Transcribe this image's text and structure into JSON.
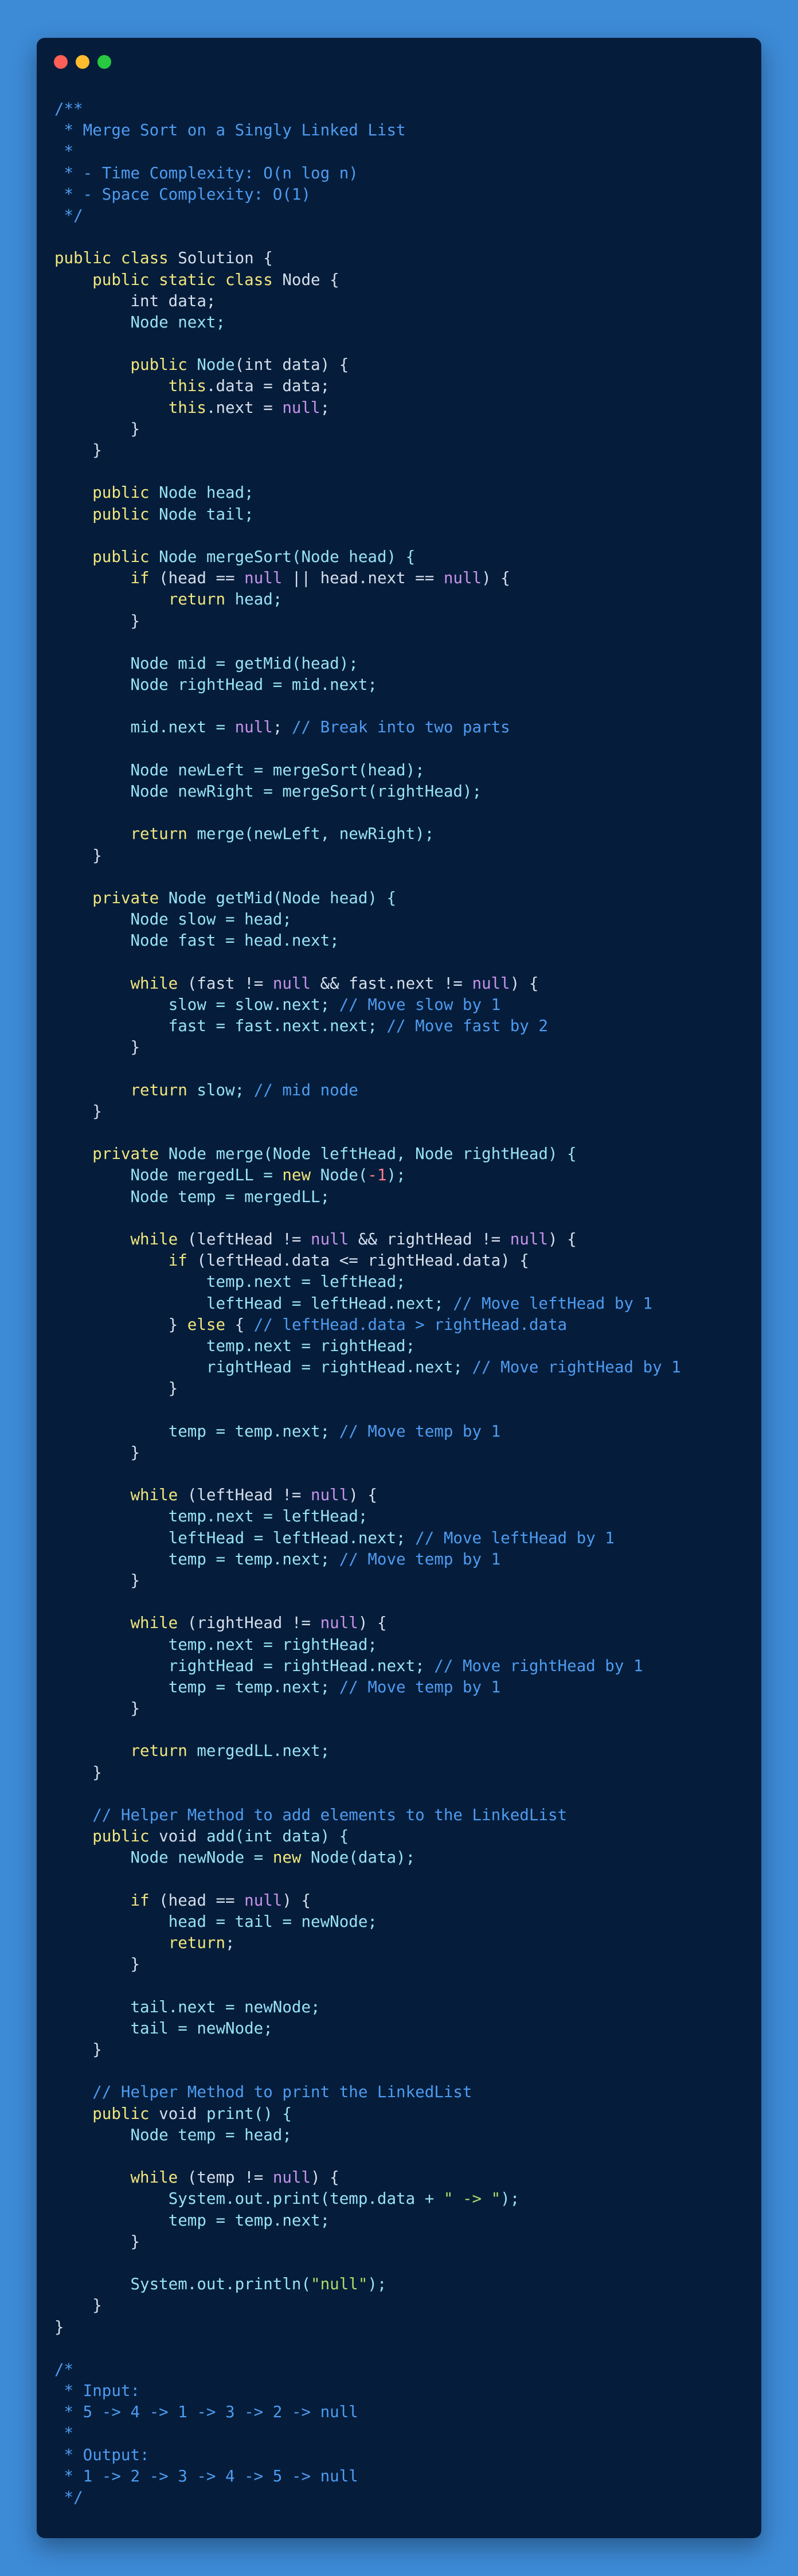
{
  "window": {
    "background": "#051d3b",
    "page_background": "#3d8ad6",
    "controls": [
      {
        "name": "close",
        "color": "#ff5f57"
      },
      {
        "name": "minimize",
        "color": "#febc2e"
      },
      {
        "name": "maximize",
        "color": "#28c840"
      }
    ]
  },
  "palette": {
    "p": "#d6deeb",
    "k": "#f2e67d",
    "c": "#4f9bf0",
    "t": "#99e2f6",
    "n": "#c792ea",
    "s": "#addb67",
    "o": "#ff7e8b"
  },
  "code_lines": [
    [
      [
        "c",
        "/**"
      ]
    ],
    [
      [
        "c",
        " * Merge Sort on a Singly Linked List"
      ]
    ],
    [
      [
        "c",
        " *"
      ]
    ],
    [
      [
        "c",
        " * - Time Complexity: O(n log n)"
      ]
    ],
    [
      [
        "c",
        " * - Space Complexity: O(1)"
      ]
    ],
    [
      [
        "c",
        " */"
      ]
    ],
    [],
    [
      [
        "k",
        "public class "
      ],
      [
        "p",
        "Solution {"
      ]
    ],
    [
      [
        "p",
        "    "
      ],
      [
        "k",
        "public static class "
      ],
      [
        "p",
        "Node {"
      ]
    ],
    [
      [
        "p",
        "        int data;"
      ]
    ],
    [
      [
        "p",
        "        "
      ],
      [
        "t",
        "Node next;"
      ]
    ],
    [],
    [
      [
        "p",
        "        "
      ],
      [
        "k",
        "public "
      ],
      [
        "t",
        "Node"
      ],
      [
        "p",
        "(int data) {"
      ]
    ],
    [
      [
        "p",
        "            "
      ],
      [
        "k",
        "this"
      ],
      [
        "p",
        ".data = data;"
      ]
    ],
    [
      [
        "p",
        "            "
      ],
      [
        "k",
        "this"
      ],
      [
        "p",
        ".next = "
      ],
      [
        "n",
        "null"
      ],
      [
        "p",
        ";"
      ]
    ],
    [
      [
        "p",
        "        }"
      ]
    ],
    [
      [
        "p",
        "    }"
      ]
    ],
    [],
    [
      [
        "p",
        "    "
      ],
      [
        "k",
        "public "
      ],
      [
        "t",
        "Node head;"
      ]
    ],
    [
      [
        "p",
        "    "
      ],
      [
        "k",
        "public "
      ],
      [
        "t",
        "Node tail;"
      ]
    ],
    [],
    [
      [
        "p",
        "    "
      ],
      [
        "k",
        "public "
      ],
      [
        "t",
        "Node mergeSort(Node head) {"
      ]
    ],
    [
      [
        "p",
        "        "
      ],
      [
        "k",
        "if "
      ],
      [
        "p",
        "(head == "
      ],
      [
        "n",
        "null"
      ],
      [
        "p",
        " || head.next == "
      ],
      [
        "n",
        "null"
      ],
      [
        "p",
        ") {"
      ]
    ],
    [
      [
        "p",
        "            "
      ],
      [
        "k",
        "return "
      ],
      [
        "t",
        "head;"
      ]
    ],
    [
      [
        "p",
        "        }"
      ]
    ],
    [],
    [
      [
        "p",
        "        "
      ],
      [
        "t",
        "Node mid = getMid(head);"
      ]
    ],
    [
      [
        "p",
        "        "
      ],
      [
        "t",
        "Node rightHead = mid.next;"
      ]
    ],
    [],
    [
      [
        "p",
        "        "
      ],
      [
        "t",
        "mid.next = "
      ],
      [
        "n",
        "null"
      ],
      [
        "p",
        "; "
      ],
      [
        "c",
        "// Break into two parts"
      ]
    ],
    [],
    [
      [
        "p",
        "        "
      ],
      [
        "t",
        "Node newLeft = mergeSort(head);"
      ]
    ],
    [
      [
        "p",
        "        "
      ],
      [
        "t",
        "Node newRight = mergeSort(rightHead);"
      ]
    ],
    [],
    [
      [
        "p",
        "        "
      ],
      [
        "k",
        "return "
      ],
      [
        "t",
        "merge(newLeft, newRight);"
      ]
    ],
    [
      [
        "p",
        "    }"
      ]
    ],
    [],
    [
      [
        "p",
        "    "
      ],
      [
        "k",
        "private "
      ],
      [
        "t",
        "Node getMid(Node head) {"
      ]
    ],
    [
      [
        "p",
        "        "
      ],
      [
        "t",
        "Node slow = head;"
      ]
    ],
    [
      [
        "p",
        "        "
      ],
      [
        "t",
        "Node fast = head.next;"
      ]
    ],
    [],
    [
      [
        "p",
        "        "
      ],
      [
        "k",
        "while "
      ],
      [
        "p",
        "(fast != "
      ],
      [
        "n",
        "null"
      ],
      [
        "p",
        " && fast.next != "
      ],
      [
        "n",
        "null"
      ],
      [
        "p",
        ") {"
      ]
    ],
    [
      [
        "p",
        "            "
      ],
      [
        "t",
        "slow = slow.next; "
      ],
      [
        "c",
        "// Move slow by 1"
      ]
    ],
    [
      [
        "p",
        "            "
      ],
      [
        "t",
        "fast = fast.next.next; "
      ],
      [
        "c",
        "// Move fast by 2"
      ]
    ],
    [
      [
        "p",
        "        }"
      ]
    ],
    [],
    [
      [
        "p",
        "        "
      ],
      [
        "k",
        "return "
      ],
      [
        "t",
        "slow; "
      ],
      [
        "c",
        "// mid node"
      ]
    ],
    [
      [
        "p",
        "    }"
      ]
    ],
    [],
    [
      [
        "p",
        "    "
      ],
      [
        "k",
        "private "
      ],
      [
        "t",
        "Node merge(Node leftHead, Node rightHead) {"
      ]
    ],
    [
      [
        "p",
        "        "
      ],
      [
        "t",
        "Node mergedLL = "
      ],
      [
        "k",
        "new "
      ],
      [
        "t",
        "Node("
      ],
      [
        "o",
        "-1"
      ],
      [
        "t",
        ");"
      ]
    ],
    [
      [
        "p",
        "        "
      ],
      [
        "t",
        "Node temp = mergedLL;"
      ]
    ],
    [],
    [
      [
        "p",
        "        "
      ],
      [
        "k",
        "while "
      ],
      [
        "p",
        "(leftHead != "
      ],
      [
        "n",
        "null"
      ],
      [
        "p",
        " && rightHead != "
      ],
      [
        "n",
        "null"
      ],
      [
        "p",
        ") {"
      ]
    ],
    [
      [
        "p",
        "            "
      ],
      [
        "k",
        "if "
      ],
      [
        "p",
        "(leftHead.data <= rightHead.data) {"
      ]
    ],
    [
      [
        "p",
        "                "
      ],
      [
        "t",
        "temp.next = leftHead;"
      ]
    ],
    [
      [
        "p",
        "                "
      ],
      [
        "t",
        "leftHead = leftHead.next; "
      ],
      [
        "c",
        "// Move leftHead by 1"
      ]
    ],
    [
      [
        "p",
        "            } "
      ],
      [
        "k",
        "else "
      ],
      [
        "p",
        "{ "
      ],
      [
        "c",
        "// leftHead.data > rightHead.data"
      ]
    ],
    [
      [
        "p",
        "                "
      ],
      [
        "t",
        "temp.next = rightHead;"
      ]
    ],
    [
      [
        "p",
        "                "
      ],
      [
        "t",
        "rightHead = rightHead.next; "
      ],
      [
        "c",
        "// Move rightHead by 1"
      ]
    ],
    [
      [
        "p",
        "            }"
      ]
    ],
    [],
    [
      [
        "p",
        "            "
      ],
      [
        "t",
        "temp = temp.next; "
      ],
      [
        "c",
        "// Move temp by 1"
      ]
    ],
    [
      [
        "p",
        "        }"
      ]
    ],
    [],
    [
      [
        "p",
        "        "
      ],
      [
        "k",
        "while "
      ],
      [
        "p",
        "(leftHead != "
      ],
      [
        "n",
        "null"
      ],
      [
        "p",
        ") {"
      ]
    ],
    [
      [
        "p",
        "            "
      ],
      [
        "t",
        "temp.next = leftHead;"
      ]
    ],
    [
      [
        "p",
        "            "
      ],
      [
        "t",
        "leftHead = leftHead.next; "
      ],
      [
        "c",
        "// Move leftHead by 1"
      ]
    ],
    [
      [
        "p",
        "            "
      ],
      [
        "t",
        "temp = temp.next; "
      ],
      [
        "c",
        "// Move temp by 1"
      ]
    ],
    [
      [
        "p",
        "        }"
      ]
    ],
    [],
    [
      [
        "p",
        "        "
      ],
      [
        "k",
        "while "
      ],
      [
        "p",
        "(rightHead != "
      ],
      [
        "n",
        "null"
      ],
      [
        "p",
        ") {"
      ]
    ],
    [
      [
        "p",
        "            "
      ],
      [
        "t",
        "temp.next = rightHead;"
      ]
    ],
    [
      [
        "p",
        "            "
      ],
      [
        "t",
        "rightHead = rightHead.next; "
      ],
      [
        "c",
        "// Move rightHead by 1"
      ]
    ],
    [
      [
        "p",
        "            "
      ],
      [
        "t",
        "temp = temp.next; "
      ],
      [
        "c",
        "// Move temp by 1"
      ]
    ],
    [
      [
        "p",
        "        }"
      ]
    ],
    [],
    [
      [
        "p",
        "        "
      ],
      [
        "k",
        "return "
      ],
      [
        "t",
        "mergedLL.next;"
      ]
    ],
    [
      [
        "p",
        "    }"
      ]
    ],
    [],
    [
      [
        "p",
        "    "
      ],
      [
        "c",
        "// Helper Method to add elements to the LinkedList"
      ]
    ],
    [
      [
        "p",
        "    "
      ],
      [
        "k",
        "public "
      ],
      [
        "p",
        "void "
      ],
      [
        "t",
        "add(int data) {"
      ]
    ],
    [
      [
        "p",
        "        "
      ],
      [
        "t",
        "Node newNode = "
      ],
      [
        "k",
        "new "
      ],
      [
        "t",
        "Node(data);"
      ]
    ],
    [],
    [
      [
        "p",
        "        "
      ],
      [
        "k",
        "if "
      ],
      [
        "p",
        "(head == "
      ],
      [
        "n",
        "null"
      ],
      [
        "p",
        ") {"
      ]
    ],
    [
      [
        "p",
        "            "
      ],
      [
        "t",
        "head = tail = newNode;"
      ]
    ],
    [
      [
        "p",
        "            "
      ],
      [
        "k",
        "return"
      ],
      [
        "p",
        ";"
      ]
    ],
    [
      [
        "p",
        "        }"
      ]
    ],
    [],
    [
      [
        "p",
        "        "
      ],
      [
        "t",
        "tail.next = newNode;"
      ]
    ],
    [
      [
        "p",
        "        "
      ],
      [
        "t",
        "tail = newNode;"
      ]
    ],
    [
      [
        "p",
        "    }"
      ]
    ],
    [],
    [
      [
        "p",
        "    "
      ],
      [
        "c",
        "// Helper Method to print the LinkedList"
      ]
    ],
    [
      [
        "p",
        "    "
      ],
      [
        "k",
        "public "
      ],
      [
        "p",
        "void "
      ],
      [
        "t",
        "print() {"
      ]
    ],
    [
      [
        "p",
        "        "
      ],
      [
        "t",
        "Node temp = head;"
      ]
    ],
    [],
    [
      [
        "p",
        "        "
      ],
      [
        "k",
        "while "
      ],
      [
        "p",
        "(temp != "
      ],
      [
        "n",
        "null"
      ],
      [
        "p",
        ") {"
      ]
    ],
    [
      [
        "p",
        "            "
      ],
      [
        "t",
        "System.out.print(temp.data + "
      ],
      [
        "s",
        "\" -> \""
      ],
      [
        "t",
        ");"
      ]
    ],
    [
      [
        "p",
        "            "
      ],
      [
        "t",
        "temp = temp.next;"
      ]
    ],
    [
      [
        "p",
        "        }"
      ]
    ],
    [],
    [
      [
        "p",
        "        "
      ],
      [
        "t",
        "System.out.println("
      ],
      [
        "s",
        "\"null\""
      ],
      [
        "t",
        ");"
      ]
    ],
    [
      [
        "p",
        "    }"
      ]
    ],
    [
      [
        "p",
        "}"
      ]
    ],
    [],
    [
      [
        "c",
        "/*"
      ]
    ],
    [
      [
        "c",
        " * Input:"
      ]
    ],
    [
      [
        "c",
        " * 5 -> 4 -> 1 -> 3 -> 2 -> null"
      ]
    ],
    [
      [
        "c",
        " *"
      ]
    ],
    [
      [
        "c",
        " * Output:"
      ]
    ],
    [
      [
        "c",
        " * 1 -> 2 -> 3 -> 4 -> 5 -> null"
      ]
    ],
    [
      [
        "c",
        " */"
      ]
    ]
  ]
}
